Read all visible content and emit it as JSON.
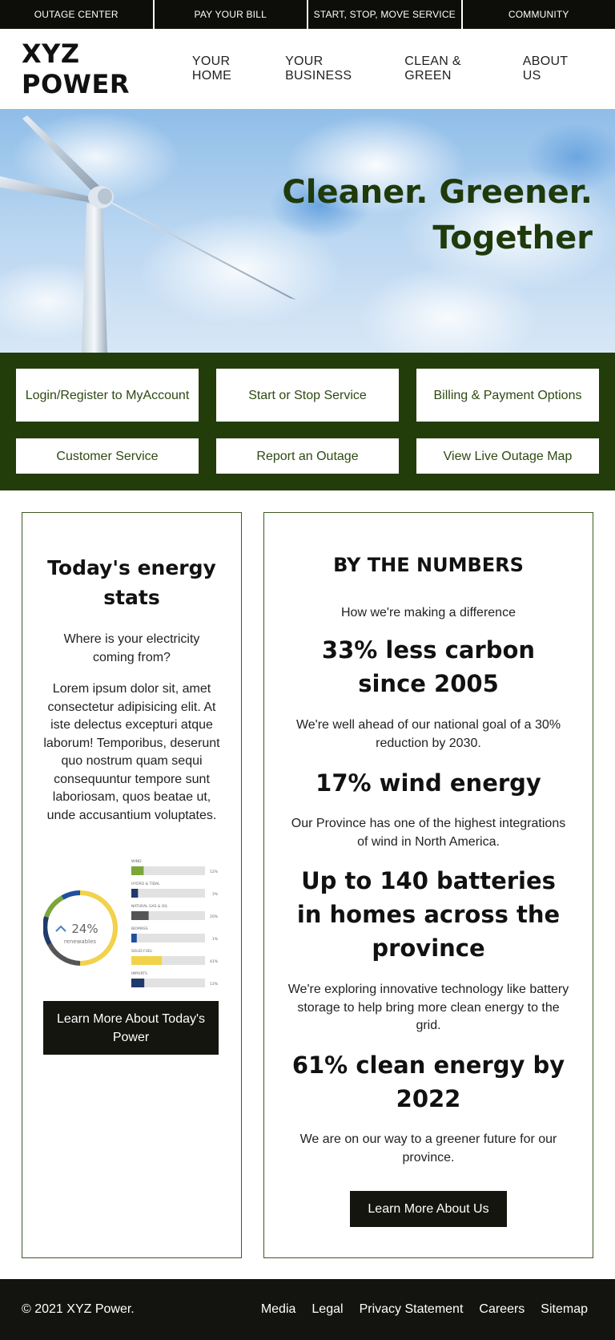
{
  "utility_nav": [
    "OUTAGE CENTER",
    "PAY YOUR BILL",
    "START, STOP, MOVE SERVICE",
    "COMMUNITY"
  ],
  "header": {
    "logo": "XYZ POWER",
    "nav": [
      "YOUR HOME",
      "YOUR BUSINESS",
      "CLEAN & GREEN",
      "ABOUT US"
    ]
  },
  "hero": {
    "line1": "Cleaner. Greener.",
    "line2": "Together"
  },
  "quick_links": [
    "Login/Register to MyAccount",
    "Start or Stop Service",
    "Billing & Payment Options",
    "Customer Service",
    "Report an Outage",
    "View Live Outage Map"
  ],
  "stats": {
    "title": "Today's energy stats",
    "subtitle": "Where is your electricity coming from?",
    "body": "Lorem ipsum dolor sit, amet consectetur adipisicing elit. At iste delectus excepturi atque laborum! Temporibus, deserunt quo nostrum quam sequi consequuntur tempore sunt laboriosam, quos beatae ut, unde accusantium voluptates.",
    "button": "Learn More About Today's Power",
    "graphic": {
      "percent": "24%",
      "caption": "renewables",
      "sources": [
        {
          "label": "WIND",
          "pct": "12%",
          "fill": 0.12,
          "color": "#7aa63a"
        },
        {
          "label": "HYDRO & TIDAL",
          "pct": "3%",
          "fill": 0.03,
          "color": "#1f3a6b"
        },
        {
          "label": "NATURAL GAS & OIL",
          "pct": "20%",
          "fill": 0.2,
          "color": "#555555"
        },
        {
          "label": "BIOMASS",
          "pct": "1%",
          "fill": 0.01,
          "color": "#1f4f9e"
        },
        {
          "label": "SOLID FUEL",
          "pct": "41%",
          "fill": 0.41,
          "color": "#f2d24b"
        },
        {
          "label": "IMPORTS",
          "pct": "13%",
          "fill": 0.13,
          "color": "#1f3a6b"
        }
      ]
    }
  },
  "numbers": {
    "title": "BY THE NUMBERS",
    "subtitle": "How we're making a difference",
    "items": [
      {
        "heading": "33% less carbon since 2005",
        "text": "We're well ahead of our national goal of a 30% reduction by 2030."
      },
      {
        "heading": "17% wind energy",
        "text": "Our Province has one of the highest integrations of wind in North America."
      },
      {
        "heading": "Up to 140 batteries in homes across the province",
        "text": "We're exploring innovative technology like battery storage to help bring more clean energy to the grid."
      },
      {
        "heading": "61% clean energy by 2022",
        "text": "We are on our way to a greener future for our province."
      }
    ],
    "button": "Learn More About Us"
  },
  "footer": {
    "copyright": "© 2021 XYZ Power.",
    "links": [
      "Media",
      "Legal",
      "Privacy Statement",
      "Careers",
      "Sitemap"
    ]
  },
  "colors": {
    "dark_green": "#233d0a",
    "headline_green": "#1f3a0b",
    "black": "#0d0d0a"
  }
}
